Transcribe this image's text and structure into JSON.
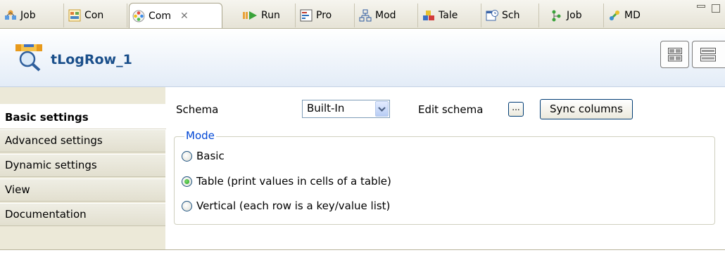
{
  "tabs": [
    {
      "label": "Job",
      "icon": "job-icon"
    },
    {
      "label": "Con",
      "icon": "contexts-icon"
    },
    {
      "label": "Com",
      "icon": "component-icon",
      "active": true
    },
    {
      "label": "Run",
      "icon": "run-icon"
    },
    {
      "label": "Pro",
      "icon": "problems-icon"
    },
    {
      "label": "Mod",
      "icon": "modules-icon"
    },
    {
      "label": "Tale",
      "icon": "talend-icon"
    },
    {
      "label": "Sch",
      "icon": "scheduler-icon"
    },
    {
      "label": "Job",
      "icon": "job-hierarchy-icon"
    },
    {
      "label": "MD",
      "icon": "metadata-icon"
    }
  ],
  "header": {
    "component_name": "tLogRow_1"
  },
  "sidebar": {
    "items": [
      {
        "label": "Basic settings",
        "active": true
      },
      {
        "label": "Advanced settings"
      },
      {
        "label": "Dynamic settings"
      },
      {
        "label": "View"
      },
      {
        "label": "Documentation"
      }
    ]
  },
  "settings": {
    "schema_label": "Schema",
    "schema_value": "Built-In",
    "edit_schema_label": "Edit schema",
    "edit_button": "...",
    "sync_button": "Sync columns",
    "mode_legend": "Mode",
    "modes": [
      {
        "label": "Basic",
        "checked": false
      },
      {
        "label": "Table (print values in cells of a table)",
        "checked": true
      },
      {
        "label": "Vertical (each row is a key/value list)",
        "checked": false
      }
    ]
  },
  "colors": {
    "title": "#1a4f8b",
    "legend": "#0046d5",
    "header_gradient_end": "#e3ecf7"
  }
}
